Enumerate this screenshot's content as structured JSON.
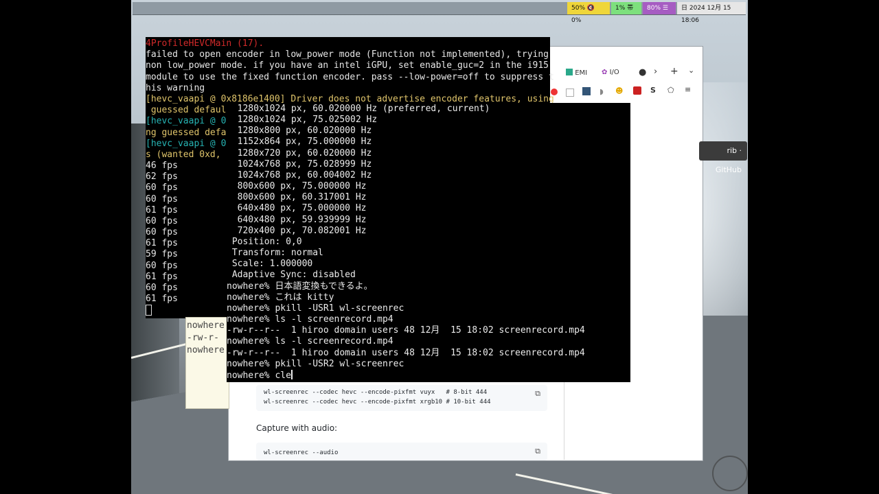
{
  "statusbar": {
    "cpu": "50% 🔇 0%",
    "net": "1% 帯",
    "battery": "80% ☰",
    "date": "日 2024 12月 15 18:06"
  },
  "browser": {
    "tabs": [
      "EMI",
      "I/O"
    ],
    "tooltip": "rib · GitHub",
    "code1": [
      "wl-screenrec --codec hevc --encode-pixfmt vuyx   # 8-bit 444",
      "wl-screenrec --codec hevc --encode-pixfmt xrgb10 # 10-bit 444"
    ],
    "capture_audio": "Capture with audio:",
    "code2": [
      "wl-screenrec --audio"
    ]
  },
  "back_terminal": {
    "lines": [
      "4ProfileHEVCMain (17).",
      "failed to open encoder in low_power mode (Function not implemented), trying",
      "non low_power mode. if you have an intel iGPU, set enable_guc=2 in the i915",
      "module to use the fixed function encoder. pass --low-power=off to suppress t",
      "his warning",
      "[hevc_vaapi @ 0x8186e1400] Driver does not advertise encoder features, using",
      " guessed defaul",
      "[hevc_vaapi @ 0",
      "ng guessed defa",
      "[hevc_vaapi @ 0",
      "s (wanted 0xd,",
      "46 fps",
      "62 fps",
      "60 fps",
      "60 fps",
      "61 fps",
      "60 fps",
      "60 fps",
      "61 fps",
      "59 fps",
      "60 fps",
      "61 fps",
      "60 fps",
      "61 fps"
    ]
  },
  "small_window": {
    "lines": [
      "nowhere",
      "-rw-r-",
      "nowhere"
    ]
  },
  "front_terminal": {
    "lines": [
      "  1280x1024 px, 60.020000 Hz (preferred, current)",
      "  1280x1024 px, 75.025002 Hz",
      "  1280x800 px, 60.020000 Hz",
      "  1152x864 px, 75.000000 Hz",
      "  1280x720 px, 60.020000 Hz",
      "  1024x768 px, 75.028999 Hz",
      "  1024x768 px, 60.004002 Hz",
      "  800x600 px, 75.000000 Hz",
      "  800x600 px, 60.317001 Hz",
      "  640x480 px, 75.000000 Hz",
      "  640x480 px, 59.939999 Hz",
      "  720x400 px, 70.082001 Hz",
      " Position: 0,0",
      " Transform: normal",
      " Scale: 1.000000",
      " Adaptive Sync: disabled",
      "nowhere% 日本語変換もできるよ。",
      "nowhere% これは kitty",
      "nowhere% pkill -USR1 wl-screenrec",
      "nowhere% ls -l screenrecord.mp4",
      "-rw-r--r--  1 hiroo domain users 48 12月  15 18:02 screenrecord.mp4",
      "nowhere% ls -l screenrecord.mp4",
      "-rw-r--r--  1 hiroo domain users 48 12月  15 18:02 screenrecord.mp4",
      "nowhere% pkill -USR2 wl-screenrec",
      "nowhere% cle"
    ]
  }
}
